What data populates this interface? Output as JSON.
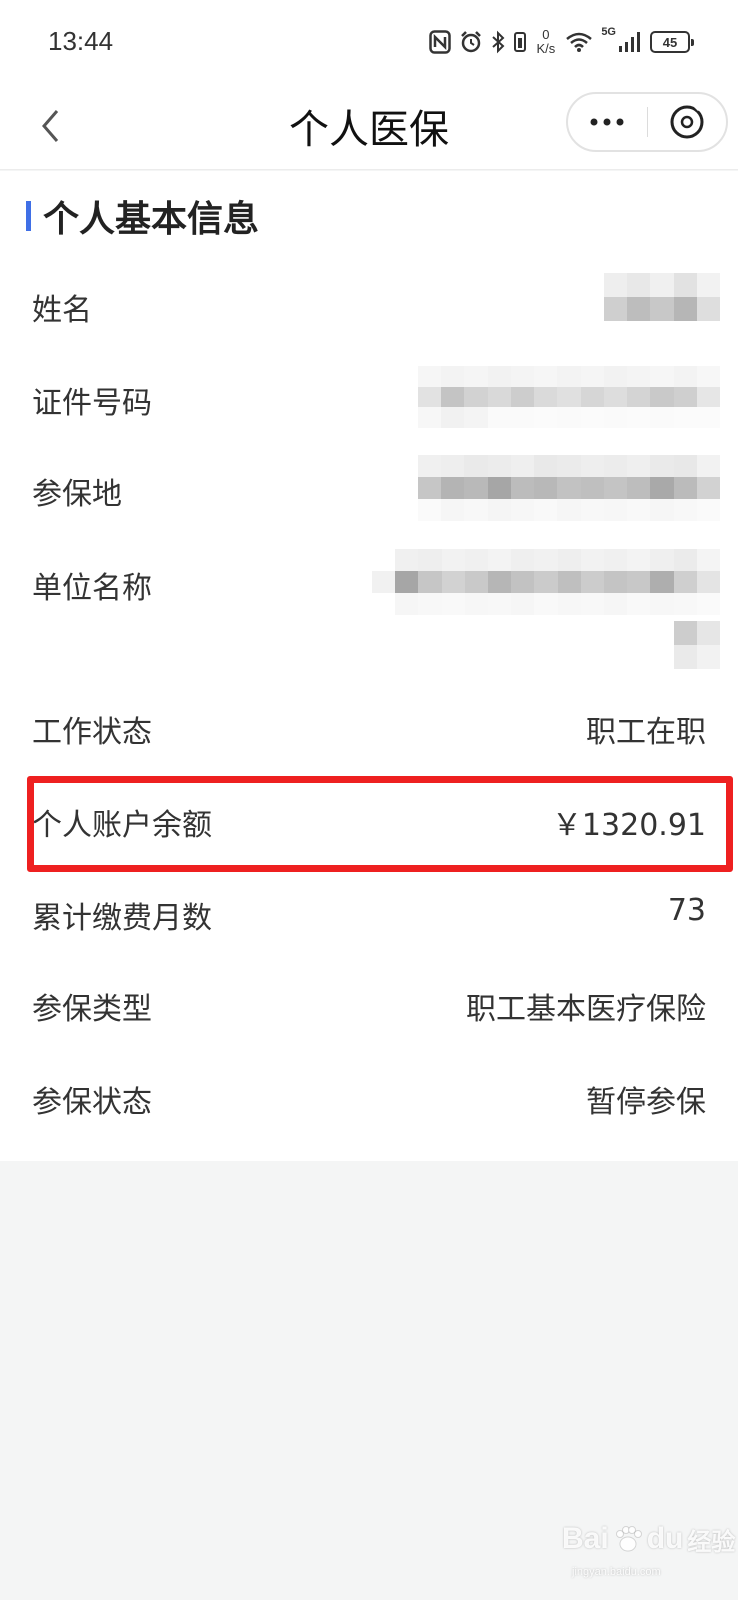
{
  "status_bar": {
    "time": "13:44",
    "net_speed_value": "0",
    "net_speed_unit": "K/s",
    "network_type": "5G",
    "battery_level": "45"
  },
  "nav": {
    "title": "个人医保",
    "more_icon": "ellipsis-icon",
    "close_icon": "close-circle-icon"
  },
  "section": {
    "title": "个人基本信息",
    "accent_color": "#3f6fe6"
  },
  "rows": [
    {
      "label": "姓名",
      "value": null,
      "redacted": true
    },
    {
      "label": "证件号码",
      "value": null,
      "redacted": true
    },
    {
      "label": "参保地",
      "value": null,
      "redacted": true
    },
    {
      "label": "单位名称",
      "value": null,
      "redacted": true
    },
    {
      "label": "工作状态",
      "value": "职工在职"
    },
    {
      "label": "个人账户余额",
      "value": "￥1320.91",
      "highlighted": true
    },
    {
      "label": "累计缴费月数",
      "value": "73"
    },
    {
      "label": "参保类型",
      "value": "职工基本医疗保险"
    },
    {
      "label": "参保状态",
      "value": "暂停参保"
    }
  ],
  "highlight_color": "#ee2020",
  "watermark": {
    "brand": "Bai",
    "brand_suffix": "du",
    "cn": "经验",
    "sub": "jingyan.baidu.com"
  }
}
